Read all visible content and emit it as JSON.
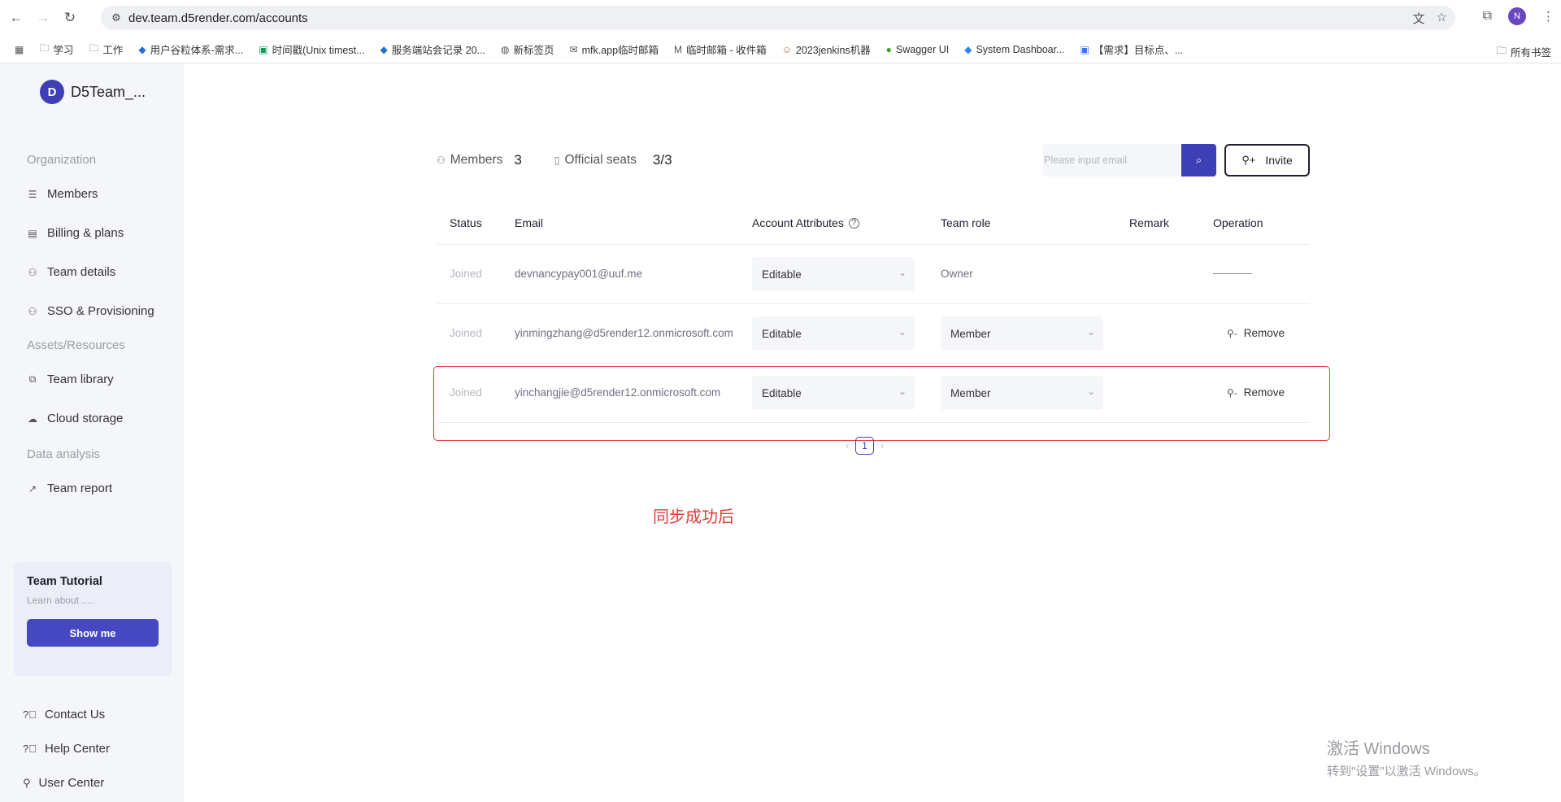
{
  "browser": {
    "url": "dev.team.d5render.com/accounts",
    "profile_initial": "N",
    "bookmarks": [
      {
        "label": "学习",
        "icon": "folder-icon"
      },
      {
        "label": "工作",
        "icon": "folder-icon"
      },
      {
        "label": "用户谷粒体系-需求...",
        "icon": "bookmark-icon"
      },
      {
        "label": "时间戳(Unix timest...",
        "icon": "bookmark-icon"
      },
      {
        "label": "服务端站会记录 20...",
        "icon": "bookmark-icon"
      },
      {
        "label": "新标签页",
        "icon": "globe-icon"
      },
      {
        "label": "mfk.app临时邮箱",
        "icon": "mail-icon"
      },
      {
        "label": "临时邮箱 - 收件箱",
        "icon": "mail-icon"
      },
      {
        "label": "2023jenkins机器",
        "icon": "jenkins-icon"
      },
      {
        "label": "Swagger UI",
        "icon": "swagger-icon"
      },
      {
        "label": "System Dashboar...",
        "icon": "jira-icon"
      },
      {
        "label": "【需求】目标点、...",
        "icon": "doc-icon"
      }
    ],
    "all_bookmarks": "所有书签"
  },
  "sidebar": {
    "team_initial": "D",
    "team_name": "D5Team_...",
    "sections": {
      "organization": "Organization",
      "assets": "Assets/Resources",
      "data": "Data analysis"
    },
    "items": {
      "members": "Members",
      "billing": "Billing & plans",
      "team_details": "Team details",
      "sso": "SSO & Provisioning",
      "team_library": "Team library",
      "cloud_storage": "Cloud storage",
      "team_report": "Team report"
    },
    "tutorial": {
      "title": "Team Tutorial",
      "subtitle": "Learn about .....",
      "button": "Show me"
    },
    "footer": {
      "contact": "Contact Us",
      "help": "Help Center",
      "user": "User Center"
    }
  },
  "main": {
    "members_label": "Members",
    "members_count": "3",
    "seats_label": "Official seats",
    "seats_value": "3/3",
    "search_placeholder": "Please input email",
    "invite_label": "Invite",
    "columns": {
      "status": "Status",
      "email": "Email",
      "attributes": "Account Attributes",
      "role": "Team role",
      "remark": "Remark",
      "operation": "Operation"
    },
    "rows": [
      {
        "status": "Joined",
        "email": "devnancypay001@uuf.me",
        "attribute": "Editable",
        "role": "Owner"
      },
      {
        "status": "Joined",
        "email": "yinmingzhang@d5render12.onmicrosoft.com",
        "attribute": "Editable",
        "role": "Member",
        "operation": "Remove"
      },
      {
        "status": "Joined",
        "email": "yinchangjie@d5render12.onmicrosoft.com",
        "attribute": "Editable",
        "role": "Member",
        "operation": "Remove"
      }
    ],
    "page": "1"
  },
  "annotation": "同步成功后",
  "watermark": {
    "line1": "激活 Windows",
    "line2": "转到\"设置\"以激活 Windows。"
  },
  "colors": {
    "accent": "#3d3fb5",
    "annotation_red": "#e53935",
    "sidebar_bg": "#f5f6fa"
  }
}
